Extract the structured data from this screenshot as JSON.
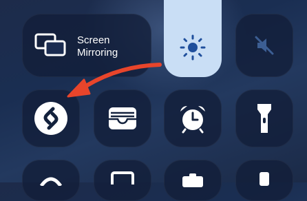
{
  "control_center": {
    "screen_mirroring": {
      "label_line1": "Screen",
      "label_line2": "Mirroring",
      "icon": "screen-mirroring-icon"
    },
    "brightness": {
      "icon": "sun-icon"
    },
    "mute": {
      "icon": "bell-slash-icon"
    },
    "row2": [
      {
        "name": "shazam",
        "icon": "shazam-icon"
      },
      {
        "name": "wallet",
        "icon": "wallet-icon"
      },
      {
        "name": "alarm",
        "icon": "alarm-clock-icon"
      },
      {
        "name": "flashlight",
        "icon": "flashlight-icon"
      }
    ],
    "annotation": {
      "icon": "red-arrow-icon",
      "color": "#e8452b"
    }
  }
}
